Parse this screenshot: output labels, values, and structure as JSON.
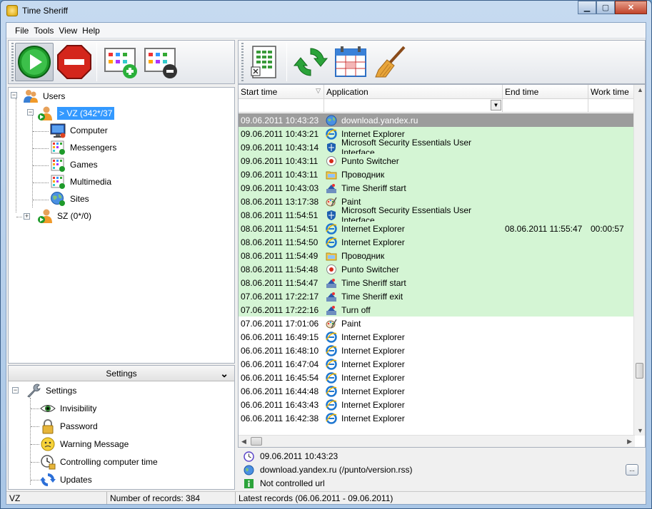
{
  "window": {
    "title": "Time Sheriff",
    "minimize": "▁",
    "maximize": "▢",
    "close": "✕"
  },
  "menu": [
    "File",
    "Tools",
    "View",
    "Help"
  ],
  "toolbar_left": [
    {
      "name": "start-icon"
    },
    {
      "name": "stop-icon"
    },
    {
      "name": "add-group-icon"
    },
    {
      "name": "remove-group-icon"
    }
  ],
  "toolbar_right": [
    {
      "name": "export-excel-icon"
    },
    {
      "name": "refresh-icon"
    },
    {
      "name": "calendar-icon"
    },
    {
      "name": "clear-broom-icon"
    }
  ],
  "tree": {
    "root": "Users",
    "selected_user": "> VZ (342*/37",
    "children": [
      "Computer",
      "Messengers",
      "Games",
      "Multimedia",
      "Sites"
    ],
    "other_user": "SZ (0*/0)"
  },
  "settings": {
    "header": "Settings",
    "root": "Settings",
    "items": [
      "Invisibility",
      "Password",
      "Warning Message",
      "Controlling computer time",
      "Updates"
    ]
  },
  "grid": {
    "columns": [
      "Start time",
      "Application",
      "End time",
      "Work time"
    ],
    "rows": [
      {
        "start": "09.06.2011 10:43:23",
        "app": "download.yandex.ru",
        "icon": "globe-icon",
        "end": "",
        "work": "",
        "state": "current"
      },
      {
        "start": "09.06.2011 10:43:21",
        "app": "Internet Explorer",
        "icon": "ie-icon",
        "end": "",
        "work": "",
        "state": "green"
      },
      {
        "start": "09.06.2011 10:43:14",
        "app": "Microsoft Security Essentials User Interface",
        "icon": "mse-icon",
        "end": "",
        "work": "",
        "state": "green"
      },
      {
        "start": "09.06.2011 10:43:11",
        "app": "Punto Switcher",
        "icon": "punto-icon",
        "end": "",
        "work": "",
        "state": "green"
      },
      {
        "start": "09.06.2011 10:43:11",
        "app": "Проводник",
        "icon": "folder-icon",
        "end": "",
        "work": "",
        "state": "green"
      },
      {
        "start": "09.06.2011 10:43:03",
        "app": "Time Sheriff start",
        "icon": "sheriff-icon",
        "end": "",
        "work": "",
        "state": "green"
      },
      {
        "start": "08.06.2011 13:17:38",
        "app": "Paint",
        "icon": "paint-icon",
        "end": "",
        "work": "",
        "state": "green"
      },
      {
        "start": "08.06.2011 11:54:51",
        "app": "Microsoft Security Essentials User Interface",
        "icon": "mse-icon",
        "end": "",
        "work": "",
        "state": "green"
      },
      {
        "start": "08.06.2011 11:54:51",
        "app": "Internet Explorer",
        "icon": "ie-icon",
        "end": "08.06.2011 11:55:47",
        "work": "00:00:57",
        "state": "green"
      },
      {
        "start": "08.06.2011 11:54:50",
        "app": "Internet Explorer",
        "icon": "ie-icon",
        "end": "",
        "work": "",
        "state": "green"
      },
      {
        "start": "08.06.2011 11:54:49",
        "app": "Проводник",
        "icon": "folder-icon",
        "end": "",
        "work": "",
        "state": "green"
      },
      {
        "start": "08.06.2011 11:54:48",
        "app": "Punto Switcher",
        "icon": "punto-icon",
        "end": "",
        "work": "",
        "state": "green"
      },
      {
        "start": "08.06.2011 11:54:47",
        "app": "Time Sheriff start",
        "icon": "sheriff-icon",
        "end": "",
        "work": "",
        "state": "green"
      },
      {
        "start": "07.06.2011 17:22:17",
        "app": "Time Sheriff exit",
        "icon": "sheriff-icon",
        "end": "",
        "work": "",
        "state": "green"
      },
      {
        "start": "07.06.2011 17:22:16",
        "app": "Turn off",
        "icon": "sheriff-icon",
        "end": "",
        "work": "",
        "state": "green"
      },
      {
        "start": "07.06.2011 17:01:06",
        "app": "Paint",
        "icon": "paint-icon",
        "end": "",
        "work": "",
        "state": "white"
      },
      {
        "start": "06.06.2011 16:49:15",
        "app": "Internet Explorer",
        "icon": "ie-icon",
        "end": "",
        "work": "",
        "state": "white"
      },
      {
        "start": "06.06.2011 16:48:10",
        "app": "Internet Explorer",
        "icon": "ie-icon",
        "end": "",
        "work": "",
        "state": "white"
      },
      {
        "start": "06.06.2011 16:47:04",
        "app": "Internet Explorer",
        "icon": "ie-icon",
        "end": "",
        "work": "",
        "state": "white"
      },
      {
        "start": "06.06.2011 16:45:54",
        "app": "Internet Explorer",
        "icon": "ie-icon",
        "end": "",
        "work": "",
        "state": "white"
      },
      {
        "start": "06.06.2011 16:44:48",
        "app": "Internet Explorer",
        "icon": "ie-icon",
        "end": "",
        "work": "",
        "state": "white"
      },
      {
        "start": "06.06.2011 16:43:43",
        "app": "Internet Explorer",
        "icon": "ie-icon",
        "end": "",
        "work": "",
        "state": "white"
      },
      {
        "start": "06.06.2011 16:42:38",
        "app": "Internet Explorer",
        "icon": "ie-icon",
        "end": "",
        "work": "",
        "state": "white"
      }
    ]
  },
  "details": {
    "time": "09.06.2011 10:43:23",
    "url": "download.yandex.ru (/punto/version.rss)",
    "status": "Not controlled url",
    "more": "..."
  },
  "status": {
    "user": "VZ",
    "records": "Number of records: 384",
    "range": "Latest records (06.06.2011 - 09.06.2011)"
  },
  "colors": {
    "green_row": "#d4f5d4",
    "current_row": "#9c9c9c",
    "selection": "#3399ff"
  }
}
